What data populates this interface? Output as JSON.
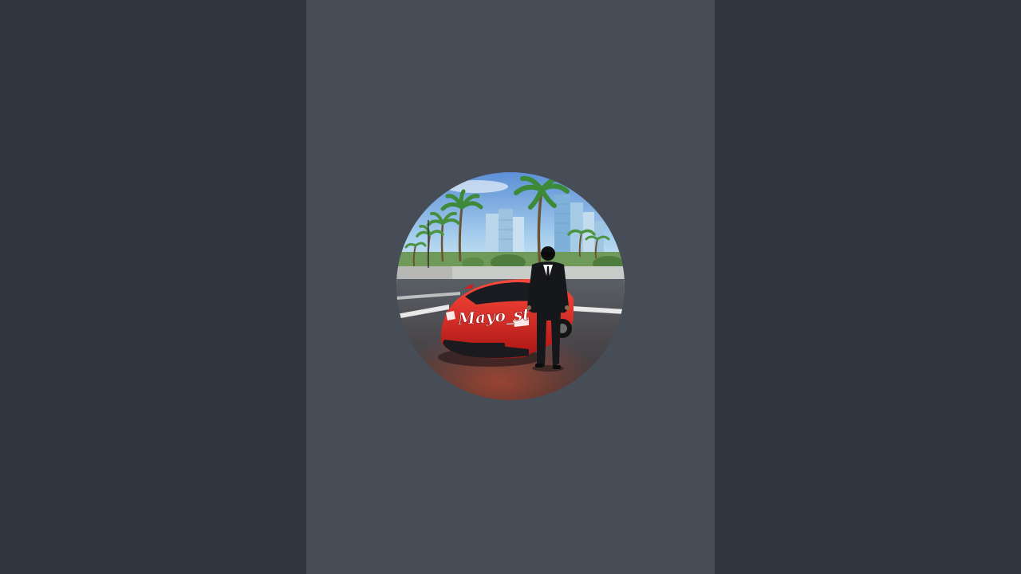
{
  "profile": {
    "avatar_label": "Mayo_st"
  }
}
